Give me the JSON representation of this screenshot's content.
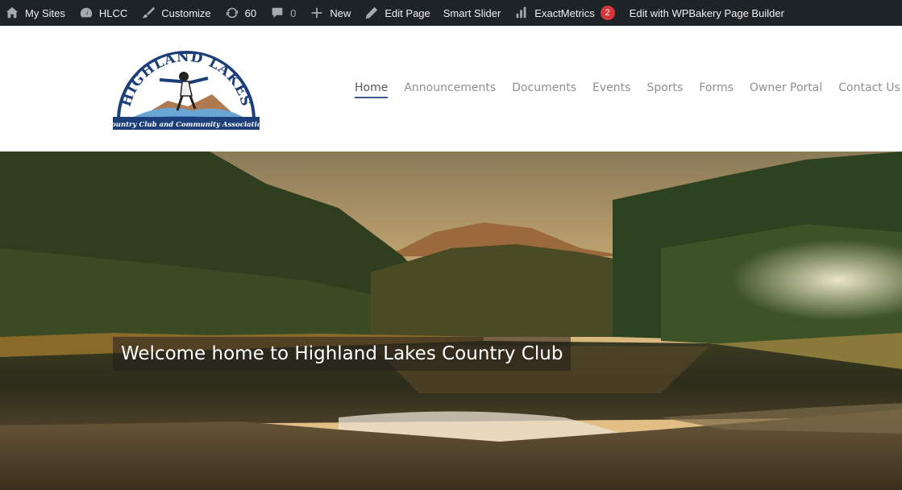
{
  "adminbar": {
    "items": [
      {
        "label": "My Sites",
        "icon": "my-sites-icon"
      },
      {
        "label": "HLCC",
        "icon": "dashboard-icon"
      },
      {
        "label": "Customize",
        "icon": "brush-icon"
      },
      {
        "label": "60",
        "icon": "updates-icon"
      },
      {
        "label": "0",
        "icon": "comments-icon"
      },
      {
        "label": "New",
        "icon": "plus-icon"
      },
      {
        "label": "Edit Page",
        "icon": "pencil-icon"
      },
      {
        "label": "Smart Slider"
      },
      {
        "label": "ExactMetrics",
        "icon": "bar-chart-icon",
        "badge": "2"
      },
      {
        "label": "Edit with WPBakery Page Builder"
      }
    ],
    "background": "#1d2327",
    "badge_color": "#d63638"
  },
  "logo": {
    "arc_text": "HIGHLAND LAKES",
    "banner_text": "Country Club and Community Association"
  },
  "nav": {
    "items": [
      {
        "label": "Home",
        "active": true
      },
      {
        "label": "Announcements"
      },
      {
        "label": "Documents"
      },
      {
        "label": "Events"
      },
      {
        "label": "Sports"
      },
      {
        "label": "Forms"
      },
      {
        "label": "Owner Portal"
      },
      {
        "label": "Contact Us"
      }
    ],
    "accent": "#3c5a8c"
  },
  "hero": {
    "title": "Welcome home to Highland Lakes Country Club"
  }
}
